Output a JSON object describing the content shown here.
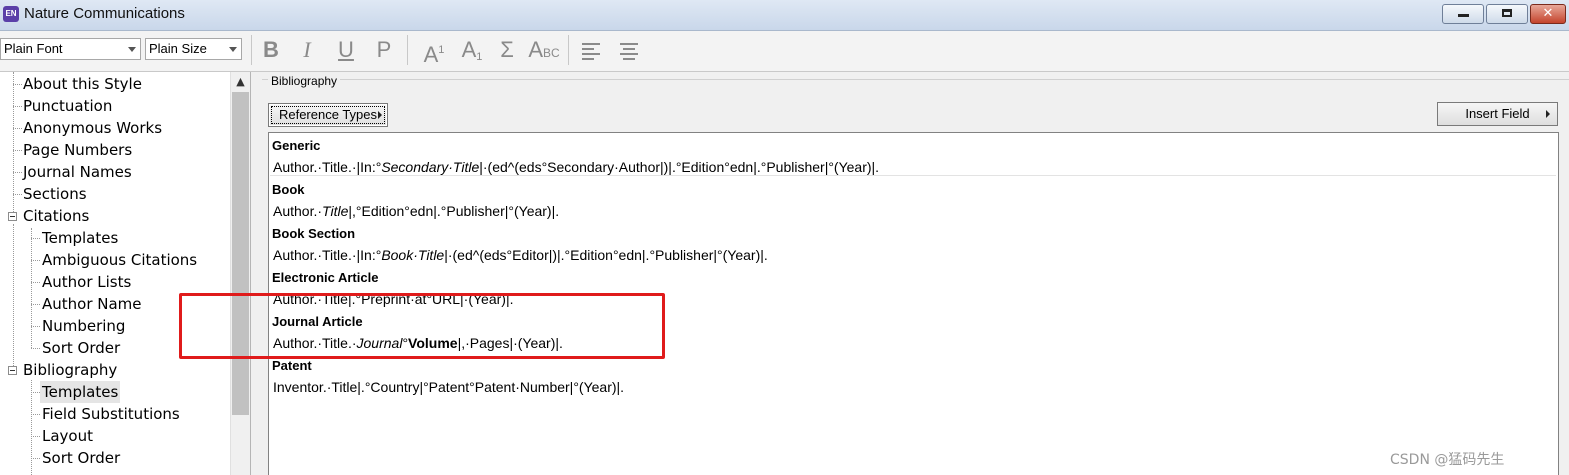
{
  "window": {
    "app_icon_label": "EN",
    "title": "Nature Communications"
  },
  "toolbar": {
    "font_select": "Plain Font",
    "size_select": "Plain Size",
    "bold_glyph": "B",
    "italic_glyph": "I",
    "underline_glyph": "U",
    "plain_glyph": "P",
    "superscript_base": "A",
    "superscript_mark": "1",
    "subscript_base": "A",
    "subscript_mark": "1",
    "symbol_glyph": "Σ",
    "smallcaps_big": "A",
    "smallcaps_small": "BC"
  },
  "tree": {
    "items": [
      {
        "label": "About this Style"
      },
      {
        "label": "Punctuation"
      },
      {
        "label": "Anonymous Works"
      },
      {
        "label": "Page Numbers"
      },
      {
        "label": "Journal Names"
      },
      {
        "label": "Sections"
      },
      {
        "label": "Citations"
      },
      {
        "label": "Templates"
      },
      {
        "label": "Ambiguous Citations"
      },
      {
        "label": "Author Lists"
      },
      {
        "label": "Author Name"
      },
      {
        "label": "Numbering"
      },
      {
        "label": "Sort Order"
      },
      {
        "label": "Bibliography"
      },
      {
        "label": "Templates"
      },
      {
        "label": "Field Substitutions"
      },
      {
        "label": "Layout"
      },
      {
        "label": "Sort Order"
      }
    ],
    "selected": "Templates"
  },
  "panel": {
    "group_label": "Bibliography",
    "reference_types_button": "Reference Types",
    "insert_field_button": "Insert Field"
  },
  "templates": [
    {
      "name": "Generic"
    },
    {
      "name": "Book"
    },
    {
      "name": "Book Section"
    },
    {
      "name": "Electronic Article"
    },
    {
      "name": "Journal Article"
    },
    {
      "name": "Patent"
    }
  ],
  "template_text": {
    "generic_a": "Author.·Title.·|In:°",
    "generic_b": "Secondary·Title",
    "generic_c": "|·(ed^(eds°Secondary·Author|)|.°Edition°edn|.°Publisher|°(Year)|.",
    "book_a": "Author.·",
    "book_b": "Title",
    "book_c": "|,°Edition°edn|.°Publisher|°(Year)|.",
    "section_a": "Author.·Title.·|In:°",
    "section_b": "Book·Title",
    "section_c": "|·(ed^(eds°Editor|)|.°Edition°edn|.°Publisher|°(Year)|.",
    "electronic": "Author.·Title|.°Preprint·at°URL|·(Year)|.",
    "journal_a": "Author.·Title.·",
    "journal_b": "Journal",
    "journal_c": "°",
    "journal_d": "Volume",
    "journal_e": "|,·Pages|·(Year)|.",
    "patent": "Inventor.·Title|.°Country|°Patent°Patent·Number|°(Year)|."
  },
  "watermark": "CSDN @猛码先生",
  "colors": {
    "highlight": "#e01b1b",
    "app_icon": "#5b3fa8"
  }
}
